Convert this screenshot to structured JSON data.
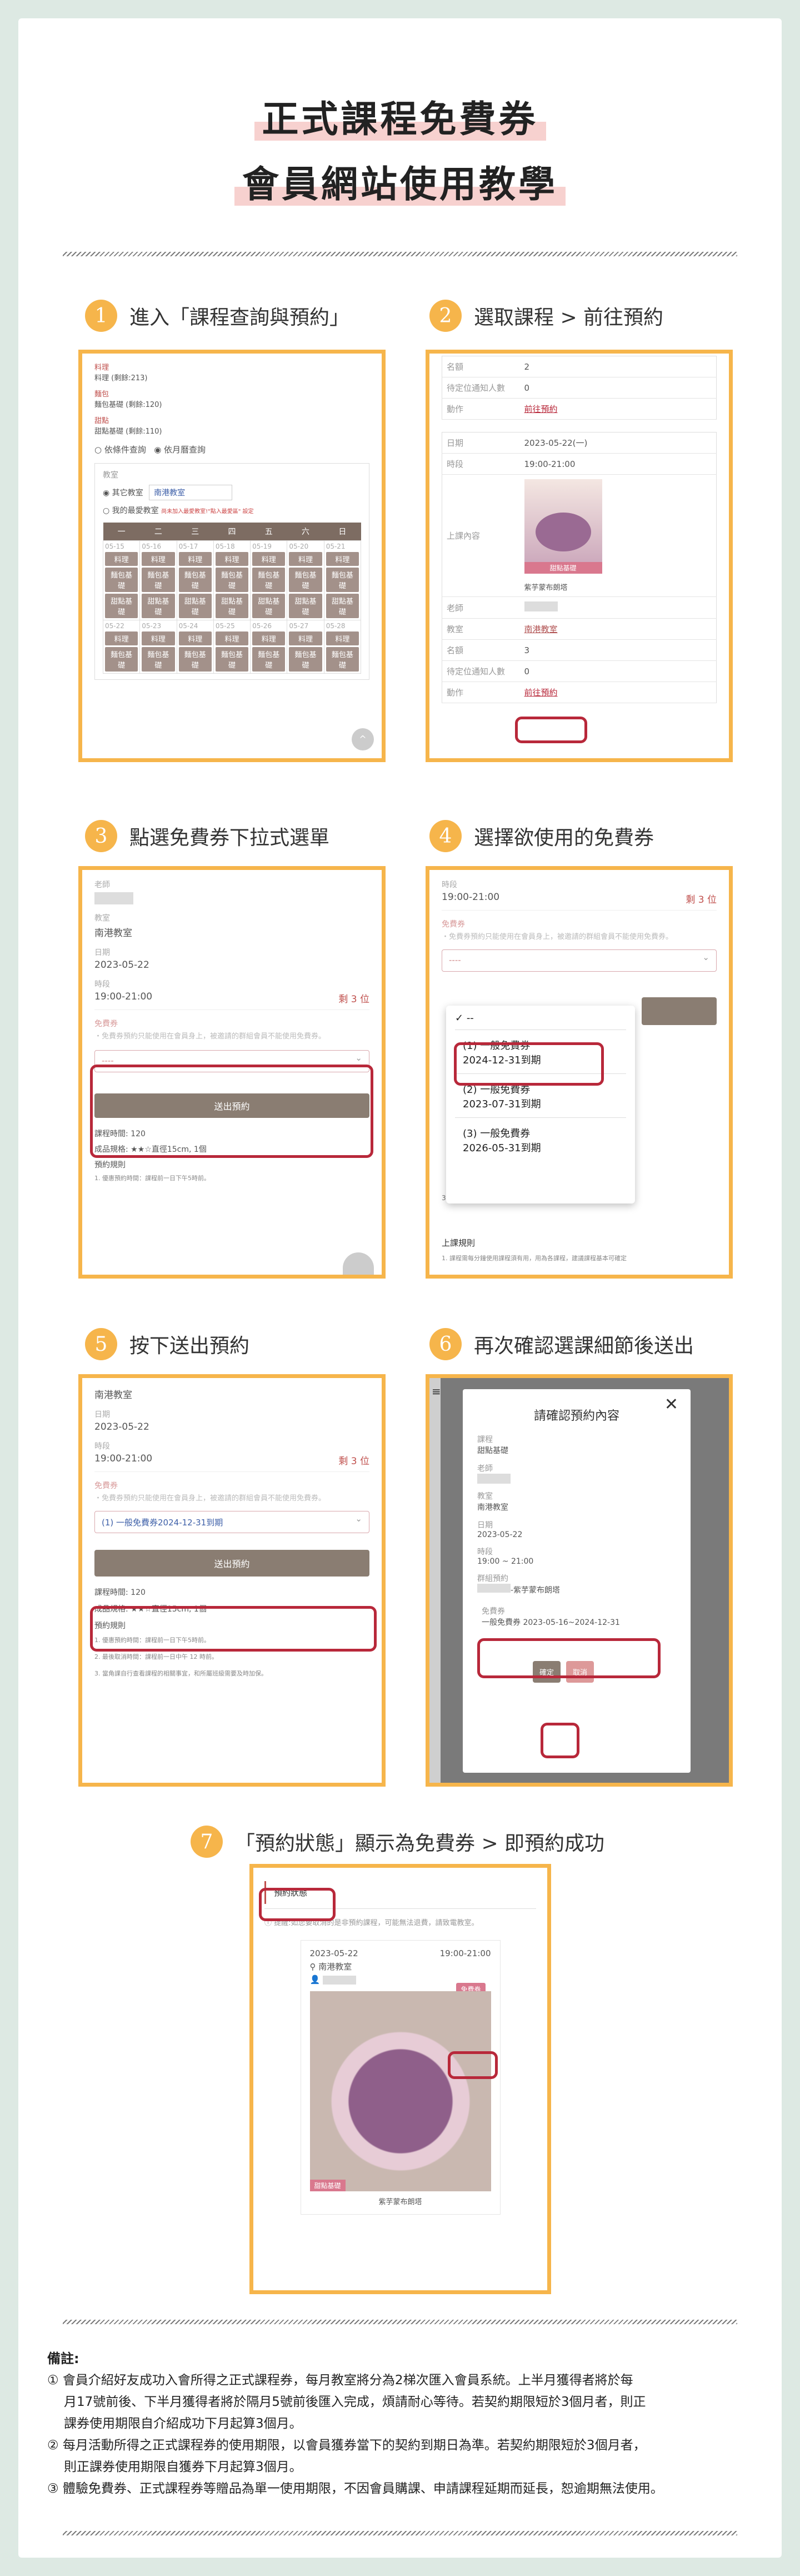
{
  "title": {
    "line1": "正式課程免費券",
    "line2": "會員網站使用教學"
  },
  "steps": [
    {
      "num": "1",
      "text": "進入「課程查詢與預約」"
    },
    {
      "num": "2",
      "text": "選取課程 > 前往預約"
    },
    {
      "num": "3",
      "text": "點選免費券下拉式選單"
    },
    {
      "num": "4",
      "text": "選擇欲使用的免費券"
    },
    {
      "num": "5",
      "text": "按下送出預約"
    },
    {
      "num": "6",
      "text": "再次確認選課細節後送出"
    },
    {
      "num": "7",
      "text": "「預約狀態」顯示為免費券 > 即預約成功"
    }
  ],
  "s1": {
    "cat1_label": "料理",
    "cat1_value": "料理 (剩餘:213)",
    "cat2_label": "麵包",
    "cat2_value": "麵包基礎 (剩餘:120)",
    "cat3_label": "甜點",
    "cat3_value": "甜點基礎 (剩餘:110)",
    "radio_date": "依條件查詢",
    "radio_month": "依月曆查詢",
    "classroom_label": "教室",
    "radio_other": "其它教室",
    "classroom_select": "南港教室",
    "radio_fav": "我的最愛教室",
    "fav_hint": "尚未加入最愛教室!",
    "fav_link": "\"點入最愛區\" 設定",
    "weekdays": [
      "一",
      "二",
      "三",
      "四",
      "五",
      "六",
      "日"
    ],
    "dates1": [
      "05-15",
      "05-16",
      "05-17",
      "05-18",
      "05-19",
      "05-20",
      "05-21"
    ],
    "dates2": [
      "05-22",
      "05-23",
      "05-24",
      "05-25",
      "05-26",
      "05-27",
      "05-28"
    ],
    "tag_cook": "料理",
    "tag_bread": "麵包基礎",
    "tag_dessert": "甜點基礎"
  },
  "s2": {
    "r1_k": "名額",
    "r1_v": "2",
    "r2_k": "待定位通知人數",
    "r2_v": "0",
    "r3_k": "動作",
    "r3_v": "前往預約",
    "date_k": "日期",
    "date_v": "2023-05-22(一)",
    "time_k": "時段",
    "time_v": "19:00-21:00",
    "content_k": "上課內容",
    "badge": "甜點基礎",
    "cake": "紫芋蒙布朗塔",
    "teacher_k": "老師",
    "room_k": "教室",
    "room_v": "南港教室",
    "seat_k": "名額",
    "seat_v": "3",
    "wait_k": "待定位通知人數",
    "wait_v": "0",
    "action_k": "動作",
    "action_v": "前往預約"
  },
  "form": {
    "teacher": "老師",
    "classroom": "教室",
    "classroom_v": "南港教室",
    "date": "日期",
    "date_v": "2023-05-22",
    "time": "時段",
    "time_v": "19:00-21:00",
    "remain": "剩 3 位",
    "coupon": "免費券",
    "coupon_hint": "・免費券預約只能使用在會員身上，被邀請的群組會員不能使用免費券。",
    "empty_opt": "----",
    "submit": "送出預約",
    "duration": "課程時間:",
    "duration_v": "120",
    "spec": "成品規格:",
    "spec_v": "★★☆直徑15cm, 1個",
    "rules": "預約規則",
    "rule1": "1. 優惠預約時間：課程前一日下午5時前。",
    "rule2": "2. 最後取消時間：課程前一日中午 12 時前。",
    "rule3": "3. 當角課自行查看課程的相關事宜，和所屬班級需要及時加保。",
    "rule3b": "1. 課程需每分鐘使用課程須有用，用為各課程，建議課程基本可確定"
  },
  "s4": {
    "options": [
      "--",
      "(1) 一般免費券",
      "2024-12-31到期",
      "(2) 一般免費券",
      "2023-07-31到期",
      "(3) 一般免費券",
      "2026-05-31到期"
    ],
    "rules_title": "上課規則"
  },
  "s5": {
    "selected": "(1) 一般免費券2024-12-31到期"
  },
  "s6": {
    "dialog_title": "請確認預約內容",
    "course": "課程",
    "course_v": "甜點基礎",
    "teacher": "老師",
    "classroom": "教室",
    "classroom_v": "南港教室",
    "date": "日期",
    "date_v": "2023-05-22",
    "time": "時段",
    "time_v": "19:00 ~ 21:00",
    "booked": "群組預約",
    "booked_v": "-紫芋蒙布朗塔",
    "coupon": "免費券",
    "coupon_v": "一般免費券 2023-05-16~2024-12-31",
    "confirm": "確定",
    "cancel": "取消"
  },
  "s7": {
    "tab": "預約狀態",
    "notice": "提醒:如您要取消的是非預約課程，可能無法退費，請致電教室。",
    "date": "2023-05-22",
    "time": "19:00-21:00",
    "place": "南港教室",
    "status": "免費券",
    "badge": "甜點基礎",
    "cake": "紫芋蒙布朗塔"
  },
  "notes": {
    "title": "備註:",
    "n1a": "① 會員介紹好友成功入會所得之正式課程券，每月教室將分為2梯次匯入會員系統。上半月獲得者將於每",
    "n1b": "月17號前後、下半月獲得者將於隔月5號前後匯入完成，煩請耐心等待。若契約期限短於3個月者，則正",
    "n1c": "課券使用期限自介紹成功下月起算3個月。",
    "n2a": "② 每月活動所得之正式課程券的使用期限，以會員獲券當下的契約到期日為準。若契約期限短於3個月者，",
    "n2b": "則正課券使用期限自獲券下月起算3個月。",
    "n3": "③ 體驗免費券、正式課程券等贈品為單一使用期限，不因會員購課、申請課程延期而延長，恕逾期無法使用。"
  },
  "colors": {
    "accent": "#f6b54b",
    "highlight": "#b8283a",
    "button": "#8a7d72",
    "background": "#dde9e3"
  }
}
